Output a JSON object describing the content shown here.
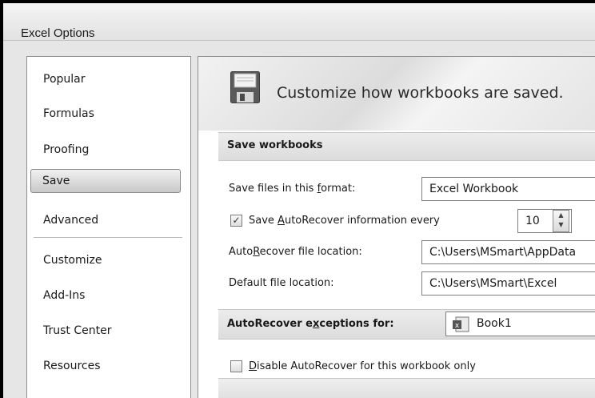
{
  "window": {
    "title": "Excel Options"
  },
  "nav": {
    "items": [
      "Popular",
      "Formulas",
      "Proofing",
      "Save",
      "Advanced",
      "Customize",
      "Add-Ins",
      "Trust Center",
      "Resources"
    ],
    "selected": "Save"
  },
  "banner": {
    "title": "Customize how workbooks are saved.",
    "icon": "floppy-disk-icon"
  },
  "save_workbooks": {
    "heading": "Save workbooks",
    "format_label_a": "Save files in this ",
    "format_label_u": "f",
    "format_label_b": "ormat:",
    "format_value": "Excel Workbook",
    "autorecover_checked": true,
    "autorecover_label_a": "Save ",
    "autorecover_label_u": "A",
    "autorecover_label_b": "utoRecover information every",
    "autorecover_minutes": "10",
    "location_label_a": "Auto",
    "location_label_u": "R",
    "location_label_b": "ecover file location:",
    "location_value": "C:\\Users\\MSmart\\AppData",
    "default_label_a": "Default f",
    "default_label_u": "i",
    "default_label_b": "le location:",
    "default_value": "C:\\Users\\MSmart\\Excel"
  },
  "exceptions": {
    "heading_a": "AutoRecover e",
    "heading_u": "x",
    "heading_b": "ceptions for:",
    "workbook": "Book1",
    "disable_checked": false,
    "disable_label_u": "D",
    "disable_label_b": "isable AutoRecover for this workbook only"
  }
}
